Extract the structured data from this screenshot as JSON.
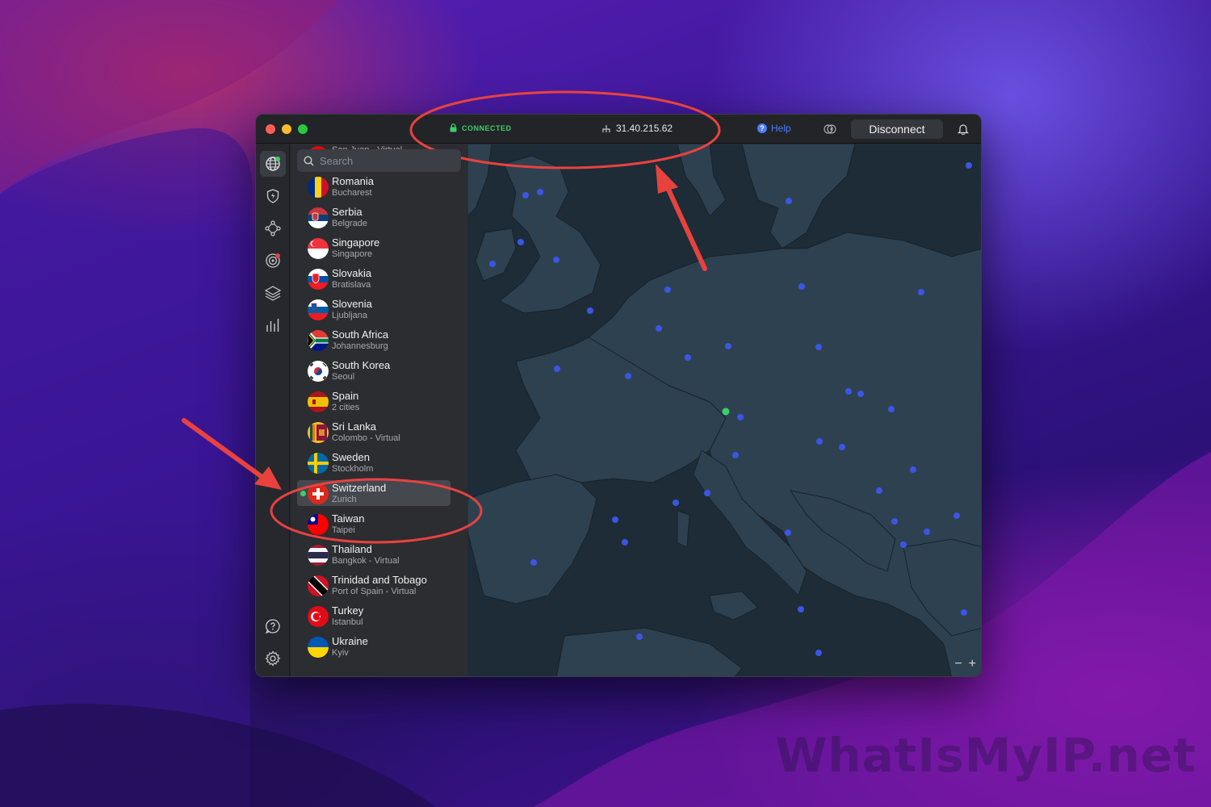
{
  "titlebar": {
    "status_text": "CONNECTED",
    "ip_address": "31.40.215.62",
    "help_label": "Help",
    "disconnect_label": "Disconnect"
  },
  "rail": {
    "items": [
      "globe-icon",
      "shield-icon",
      "meshnet-icon",
      "target-icon",
      "layers-icon",
      "stats-icon",
      "help-circle-icon",
      "gear-icon"
    ]
  },
  "search": {
    "placeholder": "Search"
  },
  "servers": [
    {
      "name": "",
      "sub": "San Juan - Virtual",
      "flag": "pr"
    },
    {
      "name": "Romania",
      "sub": "Bucharest",
      "flag": "ro"
    },
    {
      "name": "Serbia",
      "sub": "Belgrade",
      "flag": "rs"
    },
    {
      "name": "Singapore",
      "sub": "Singapore",
      "flag": "sg"
    },
    {
      "name": "Slovakia",
      "sub": "Bratislava",
      "flag": "sk"
    },
    {
      "name": "Slovenia",
      "sub": "Ljubljana",
      "flag": "si"
    },
    {
      "name": "South Africa",
      "sub": "Johannesburg",
      "flag": "za"
    },
    {
      "name": "South Korea",
      "sub": "Seoul",
      "flag": "kr"
    },
    {
      "name": "Spain",
      "sub": "2 cities",
      "flag": "es"
    },
    {
      "name": "Sri Lanka",
      "sub": "Colombo - Virtual",
      "flag": "lk"
    },
    {
      "name": "Sweden",
      "sub": "Stockholm",
      "flag": "se"
    },
    {
      "name": "Switzerland",
      "sub": "Zurich",
      "flag": "ch",
      "selected": true
    },
    {
      "name": "Taiwan",
      "sub": "Taipei",
      "flag": "tw"
    },
    {
      "name": "Thailand",
      "sub": "Bangkok - Virtual",
      "flag": "th"
    },
    {
      "name": "Trinidad and Tobago",
      "sub": "Port of Spain - Virtual",
      "flag": "tt"
    },
    {
      "name": "Turkey",
      "sub": "Istanbul",
      "flag": "tr"
    },
    {
      "name": "Ukraine",
      "sub": "Kyiv",
      "flag": "ua"
    }
  ],
  "map": {
    "zoom_out": "−",
    "zoom_in": "+"
  },
  "watermark": "WhatIsMyIP.net",
  "colors": {
    "connected": "#3ecf6a",
    "accent": "#4f7cff",
    "annotation": "#e8423f",
    "server_dot": "#3b56e6"
  }
}
